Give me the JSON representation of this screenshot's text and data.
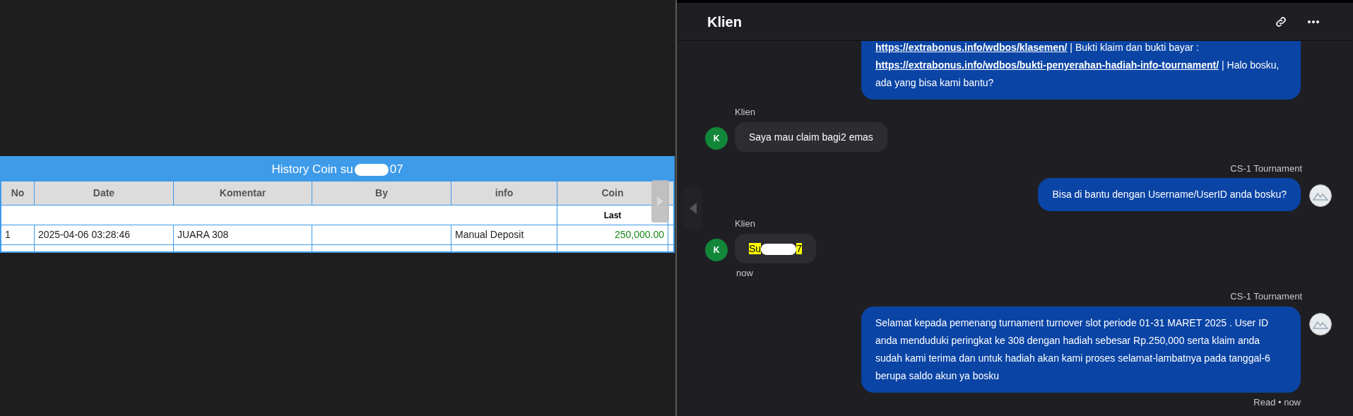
{
  "history_table": {
    "title_prefix": "History Coin su",
    "title_suffix": "07",
    "columns": [
      "No",
      "Date",
      "Komentar",
      "By",
      "info",
      "Coin"
    ],
    "subheader": "Last",
    "rows": [
      {
        "cells": [
          "1",
          "2025-04-06 03:28:46",
          "JUARA 308",
          "",
          "Manual Deposit",
          "250,000.00"
        ]
      }
    ]
  },
  "chat": {
    "title": "Klien",
    "messages": [
      {
        "kind": "outgoing",
        "parts": [
          {
            "kind": "link",
            "text": "https://extrabonus.info/wdbos/klasemen/"
          },
          {
            "kind": "text",
            "text": " | Bukti klaim dan bukti bayar : "
          },
          {
            "kind": "link",
            "text": "https://extrabonus.info/wdbos/bukti-penyerahan-hadiah-info-tournament/"
          },
          {
            "kind": "text",
            "text": " | Halo bosku, ada yang bisa kami bantu?"
          }
        ]
      },
      {
        "kind": "incoming",
        "sender": "Klien",
        "avatar": "K",
        "parts": [
          {
            "kind": "text",
            "text": "Saya mau claim bagi2 emas"
          }
        ]
      },
      {
        "kind": "outgoing",
        "sender": "CS-1 Tournament",
        "parts": [
          {
            "kind": "text",
            "text": "Bisa di bantu dengan Username/UserID anda bosku?"
          }
        ]
      },
      {
        "kind": "incoming",
        "sender": "Klien",
        "avatar": "K",
        "parts": [
          {
            "kind": "highlight",
            "text": "Su"
          },
          {
            "kind": "redaction"
          },
          {
            "kind": "highlight",
            "text": "7"
          }
        ],
        "footer": "now"
      },
      {
        "kind": "outgoing",
        "sender": "CS-1 Tournament",
        "parts": [
          {
            "kind": "text",
            "text": "Selamat kepada pemenang turnament turnover slot periode 01-31 MARET 2025 . User ID anda menduduki peringkat ke 308 dengan hadiah sebesar Rp.250,000 serta klaim anda sudah kami terima dan untuk hadiah akan kami proses selamat-lambatnya pada tanggal-6 berupa saldo akun ya bosku"
          }
        ],
        "footer": "Read • now"
      }
    ]
  }
}
